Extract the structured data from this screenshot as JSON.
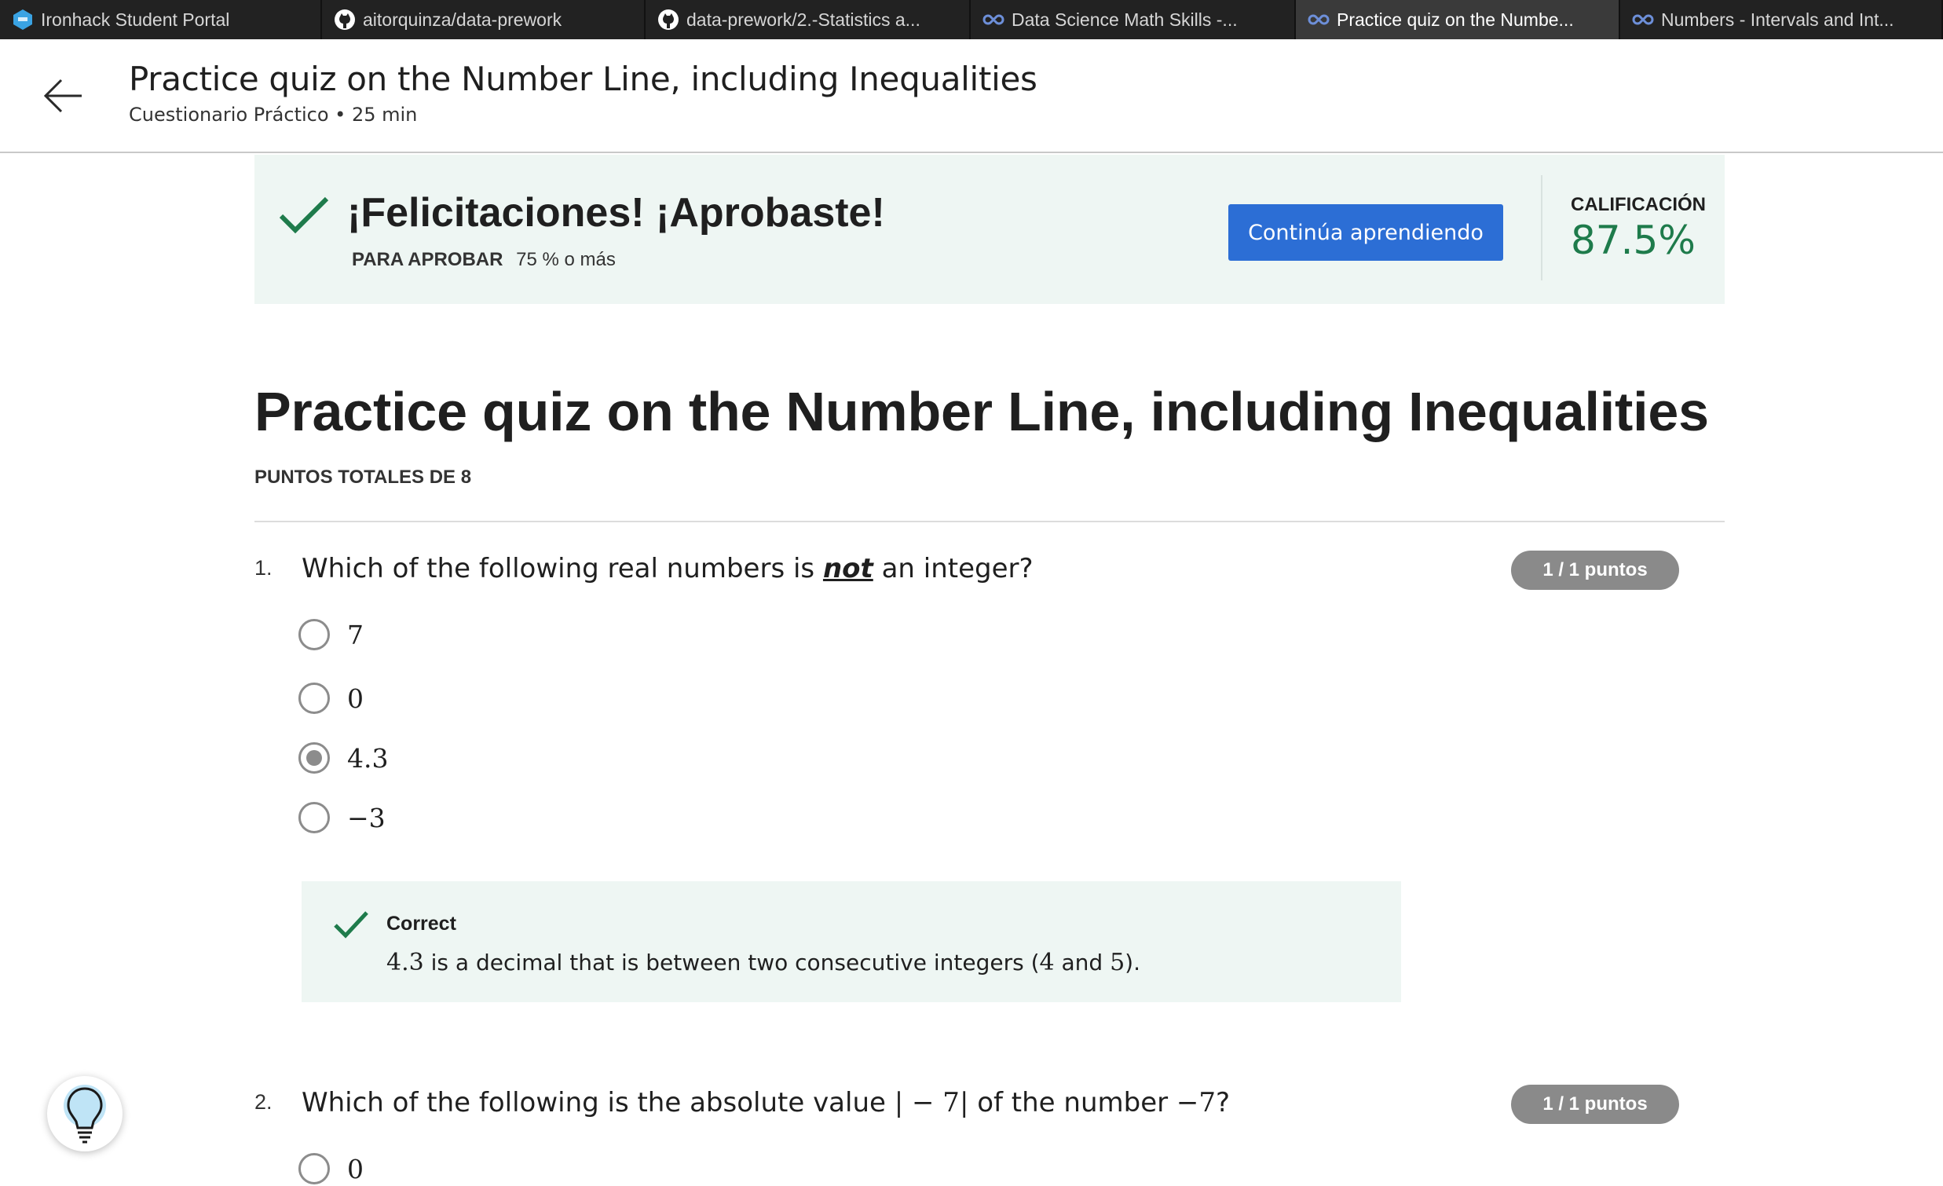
{
  "browser": {
    "tabs": [
      {
        "label": "Ironhack Student Portal",
        "icon": "ironhack-logo-icon",
        "active": false
      },
      {
        "label": "aitorquinza/data-prework",
        "icon": "github-icon",
        "active": false
      },
      {
        "label": "data-prework/2.-Statistics a...",
        "icon": "github-icon",
        "active": false
      },
      {
        "label": "Data Science Math Skills -...",
        "icon": "coursera-icon",
        "active": false
      },
      {
        "label": "Practice quiz on the Numbe...",
        "icon": "coursera-icon",
        "active": true
      },
      {
        "label": "Numbers - Intervals and Int...",
        "icon": "coursera-icon",
        "active": false
      }
    ]
  },
  "header": {
    "title": "Practice quiz on the Number Line, including Inequalities",
    "subtitle": "Cuestionario Práctico • 25 min"
  },
  "banner": {
    "title": "¡Felicitaciones! ¡Aprobaste!",
    "pass_label": "PARA APROBAR",
    "pass_value": "75 % o más",
    "continue_label": "Continúa aprendiendo",
    "grade_label": "CALIFICACIÓN",
    "grade_value": "87.5%"
  },
  "quiz": {
    "title": "Practice quiz on the Number Line, including Inequalities",
    "total_points": "PUNTOS TOTALES DE 8",
    "questions": [
      {
        "number": "1.",
        "text_before": "Which of the following real numbers is ",
        "text_emph": "not",
        "text_after": " an integer?",
        "points": "1 / 1 puntos",
        "options": [
          {
            "label": "7",
            "selected": false
          },
          {
            "label": "0",
            "selected": false
          },
          {
            "label": "4.3",
            "selected": true
          },
          {
            "label": "−3",
            "selected": false
          }
        ],
        "feedback": {
          "title": "Correct",
          "math1": "4.3",
          "text1": " is a decimal that is between two consecutive integers (",
          "math2": "4",
          "text2": " and ",
          "math3": "5",
          "text3": ")."
        }
      },
      {
        "number": "2.",
        "text_before": "Which of the following is the absolute value ",
        "math1": "| − 7|",
        "text_mid": " of the number ",
        "math2": "−7",
        "text_after": "?",
        "points": "1 / 1 puntos",
        "options": [
          {
            "label": "0",
            "selected": false
          }
        ]
      }
    ]
  },
  "colors": {
    "accent": "#2c6ed5",
    "success": "#1e7b4b",
    "banner_bg": "#eef6f3",
    "badge_bg": "#8a8a8a"
  }
}
